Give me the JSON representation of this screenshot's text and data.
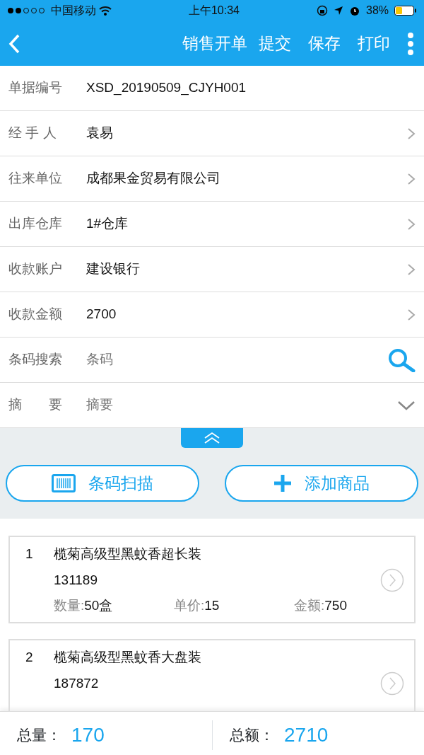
{
  "status_bar": {
    "carrier": "中国移动",
    "time": "上午10:34",
    "battery": "38%"
  },
  "nav": {
    "title": "销售开单",
    "actions": [
      "提交",
      "保存",
      "打印"
    ]
  },
  "fields": [
    {
      "kind": "static",
      "label": "单据编号",
      "value": "XSD_20190509_CJYH001"
    },
    {
      "kind": "select",
      "label": "经 手 人",
      "value": "袁易"
    },
    {
      "kind": "select",
      "label": "往来单位",
      "value": "成都果金贸易有限公司"
    },
    {
      "kind": "select",
      "label": "出库仓库",
      "value": "1#仓库"
    },
    {
      "kind": "select",
      "label": "收款账户",
      "value": "建设银行"
    },
    {
      "kind": "select",
      "label": "收款金额",
      "value": "2700"
    },
    {
      "kind": "search",
      "label": "条码搜索",
      "placeholder": "条码"
    },
    {
      "kind": "expand",
      "label": "摘　　要",
      "placeholder": "摘要"
    }
  ],
  "buttons": [
    {
      "kind": "scan",
      "label": "条码扫描"
    },
    {
      "kind": "add",
      "label": "添加商品"
    }
  ],
  "items": [
    {
      "index": "1",
      "name": "榄菊高级型黑蚊香超长装",
      "code": "131189",
      "quantity": "数量:50盒",
      "price": "单价:15",
      "amount": "金额:750"
    },
    {
      "index": "2",
      "name": "榄菊高级型黑蚊香大盘装",
      "code": "187872"
    }
  ],
  "totals": [
    {
      "label": "总量：",
      "value": "170"
    },
    {
      "label": "总额：",
      "value": "2710"
    }
  ]
}
